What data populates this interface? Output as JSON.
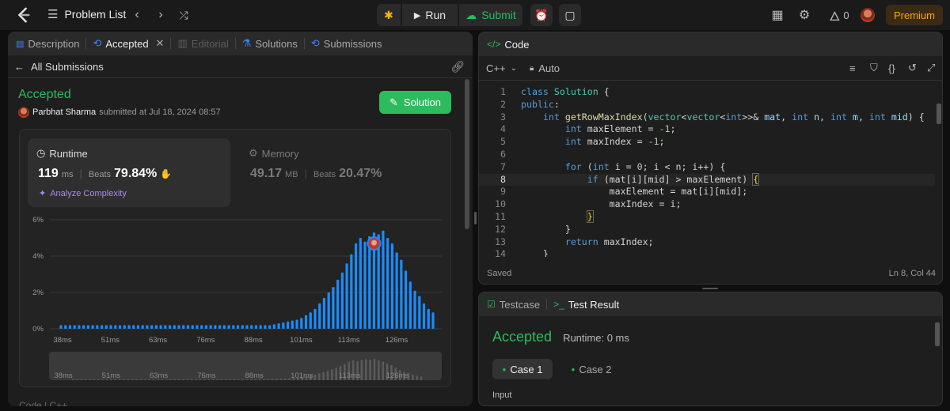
{
  "topbar": {
    "problem_list": "Problem List",
    "run": "Run",
    "submit": "Submit",
    "streak": "0",
    "premium": "Premium"
  },
  "left": {
    "tabs": [
      "Description",
      "Accepted",
      "Editorial",
      "Solutions",
      "Submissions"
    ],
    "all_submissions": "All Submissions",
    "status": "Accepted",
    "user": "Parbhat Sharma",
    "submitted_at": "submitted at Jul 18, 2024 08:57",
    "solution_btn": "Solution",
    "runtime_label": "Runtime",
    "runtime_value": "119",
    "runtime_unit": "ms",
    "beats_label": "Beats",
    "runtime_beats": "79.84%",
    "analyze": "Analyze Complexity",
    "memory_label": "Memory",
    "memory_value": "49.17",
    "memory_unit": "MB",
    "memory_beats": "20.47%",
    "footer_text": "Code | C++"
  },
  "chart_data": {
    "type": "bar",
    "title": "",
    "xlabel": "",
    "ylabel": "",
    "ylim": [
      0,
      6
    ],
    "y_ticks": [
      "6%",
      "4%",
      "2%",
      "0%"
    ],
    "x_ticks": [
      "38ms",
      "51ms",
      "63ms",
      "76ms",
      "88ms",
      "101ms",
      "113ms",
      "126ms"
    ],
    "values": [
      0.2,
      0.2,
      0.2,
      0.2,
      0.2,
      0.2,
      0.2,
      0.2,
      0.2,
      0.2,
      0.2,
      0.2,
      0.2,
      0.2,
      0.2,
      0.2,
      0.2,
      0.2,
      0.2,
      0.2,
      0.2,
      0.2,
      0.2,
      0.2,
      0.2,
      0.2,
      0.2,
      0.2,
      0.2,
      0.2,
      0.2,
      0.2,
      0.2,
      0.2,
      0.2,
      0.2,
      0.2,
      0.2,
      0.2,
      0.2,
      0.2,
      0.2,
      0.2,
      0.2,
      0.2,
      0.2,
      0.2,
      0.25,
      0.3,
      0.35,
      0.4,
      0.45,
      0.5,
      0.6,
      0.75,
      0.9,
      1.1,
      1.4,
      1.7,
      2.0,
      2.3,
      2.7,
      3.1,
      3.6,
      4.1,
      4.7,
      5.0,
      4.8,
      5.1,
      5.3,
      5.2,
      5.4,
      5.0,
      4.7,
      4.2,
      3.8,
      3.2,
      2.6,
      2.1,
      1.8,
      1.4,
      1.1,
      0.9
    ],
    "highlight_index": 69,
    "bar_color": "#1a8cff"
  },
  "code_panel": {
    "title": "Code",
    "lang": "C++",
    "auto": "Auto",
    "saved": "Saved",
    "cursor": "Ln 8, Col 44",
    "lines": [
      "1",
      "2",
      "3",
      "4",
      "5",
      "6",
      "7",
      "8",
      "9",
      "10",
      "11",
      "12",
      "13",
      "14"
    ]
  },
  "result_panel": {
    "testcase_tab": "Testcase",
    "result_tab": "Test Result",
    "status": "Accepted",
    "runtime": "Runtime: 0 ms",
    "case1": "Case 1",
    "case2": "Case 2",
    "input_label": "Input"
  }
}
